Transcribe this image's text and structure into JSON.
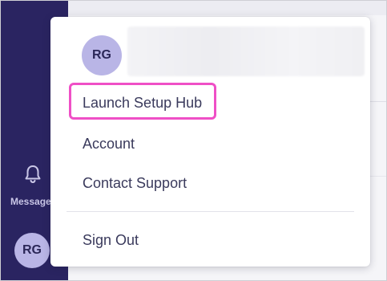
{
  "sidebar": {
    "messages_label": "Message",
    "avatar_initials": "RG"
  },
  "menu": {
    "avatar_initials": "RG",
    "items": [
      {
        "label": "Launch Setup Hub"
      },
      {
        "label": "Account"
      },
      {
        "label": "Contact Support"
      }
    ],
    "signout_label": "Sign Out"
  },
  "icons": {
    "bell": "bell-icon"
  },
  "colors": {
    "sidebar_bg": "#2a2461",
    "avatar_bg": "#b9b5e6",
    "highlight": "#ef4fc6",
    "text": "#3a3a5c"
  }
}
